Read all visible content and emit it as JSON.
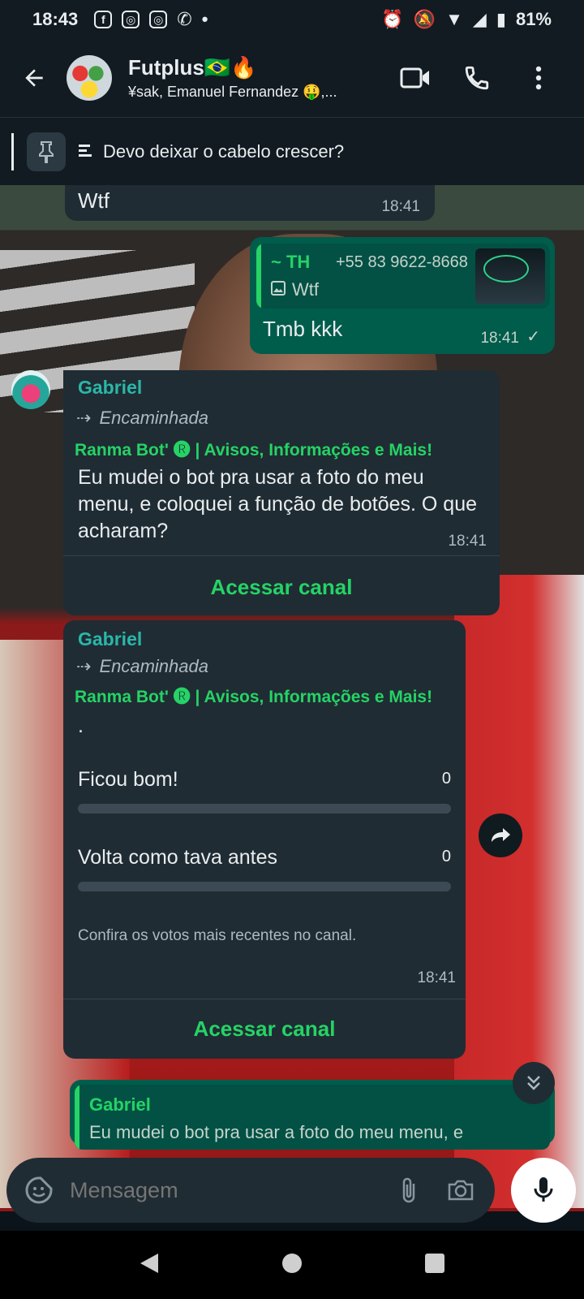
{
  "status_bar": {
    "time": "18:43",
    "battery": "81%",
    "icons": [
      "facebook-icon",
      "instagram-icon",
      "instagram-icon",
      "whatsapp-icon",
      "dot-icon",
      "alarm-icon",
      "mute-icon",
      "data-icon",
      "wifi-icon",
      "signal-icon",
      "battery-icon"
    ]
  },
  "header": {
    "group_name": "Futplus🇧🇷🔥",
    "subtitle": "¥sak, Emanuel Fernandez 🤑,..."
  },
  "pinned": {
    "text": "Devo deixar o cabelo crescer?"
  },
  "messages": [
    {
      "type": "incoming",
      "text": "Wtf",
      "time": "18:41"
    },
    {
      "type": "outgoing",
      "quote_author": "~ TH",
      "quote_phone": "+55 83 9622-8668",
      "quote_text": "Wtf",
      "text": "Tmb kkk",
      "time": "18:41"
    },
    {
      "type": "incoming",
      "sender": "Gabriel",
      "forwarded": "Encaminhada",
      "channel": "Ranma Bot' 🅡 | Avisos, Informações e Mais!",
      "text": "Eu mudei o bot pra usar a foto do meu menu, e coloquei a função de botões. O que acharam?",
      "time": "18:41",
      "action": "Acessar canal"
    },
    {
      "type": "poll",
      "sender": "Gabriel",
      "forwarded": "Encaminhada",
      "channel": "Ranma Bot' 🅡 | Avisos, Informações e Mais!",
      "question": ".",
      "options": [
        {
          "label": "Ficou bom!",
          "count": "0",
          "fraction": 0
        },
        {
          "label": "Volta como tava antes",
          "count": "0",
          "fraction": 0
        }
      ],
      "note": "Confira os votos mais recentes no canal.",
      "time": "18:41",
      "action": "Acessar canal"
    },
    {
      "type": "outgoing_partial",
      "quote_author": "Gabriel",
      "quote_text": "Eu mudei o bot pra usar a foto do meu menu, e"
    }
  ],
  "composer": {
    "placeholder": "Mensagem"
  },
  "colors": {
    "accent": "#25d366",
    "outgoing_bubble": "#005c4b",
    "incoming_bubble": "#202c33",
    "header_bg": "#111b21"
  }
}
